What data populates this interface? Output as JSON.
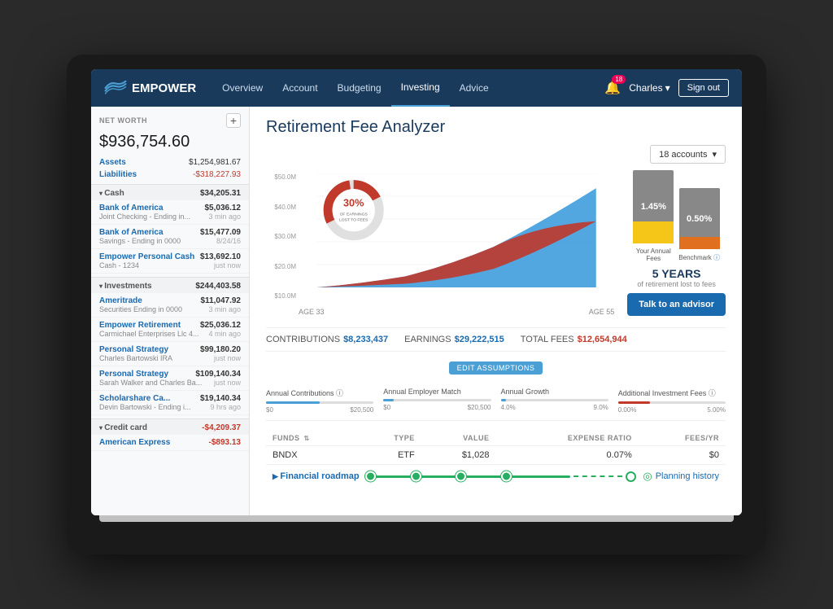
{
  "nav": {
    "logo": "EMPOWER",
    "links": [
      {
        "label": "Overview",
        "active": false
      },
      {
        "label": "Account",
        "active": false
      },
      {
        "label": "Budgeting",
        "active": false
      },
      {
        "label": "Investing",
        "active": true
      },
      {
        "label": "Advice",
        "active": false
      }
    ],
    "bell_count": "18",
    "user": "Charles",
    "signout": "Sign out"
  },
  "sidebar": {
    "header": "NET WORTH",
    "add_btn": "+",
    "net_worth": "$936,754.60",
    "assets_label": "Assets",
    "assets_value": "$1,254,981.67",
    "liabilities_label": "Liabilities",
    "liabilities_value": "-$318,227.93",
    "sections": [
      {
        "title": "Cash",
        "amount": "$34,205.31",
        "accounts": [
          {
            "name": "Bank of America",
            "sub": "Joint Checking - Ending in...",
            "value": "$5,036.12",
            "time": "3 min ago"
          },
          {
            "name": "Bank of America",
            "sub": "Savings - Ending in 0000",
            "value": "$15,477.09",
            "time": "8/24/16"
          },
          {
            "name": "Empower Personal Cash",
            "sub": "Cash - 1234",
            "value": "$13,692.10",
            "time": "just now"
          }
        ]
      },
      {
        "title": "Investments",
        "amount": "$244,403.58",
        "accounts": [
          {
            "name": "Ameritrade",
            "sub": "Securities Ending in 0000",
            "value": "$11,047.92",
            "time": "3 min ago"
          },
          {
            "name": "Empower Retirement",
            "sub": "Carmichael Enterprises Llc 4...",
            "value": "$25,036.12",
            "time": "4 min ago"
          },
          {
            "name": "Personal Strategy",
            "sub": "Charles Bartowski IRA",
            "value": "$99,180.20",
            "time": "just now"
          },
          {
            "name": "Personal Strategy",
            "sub": "Sarah Walker and Charles Ba...",
            "value": "$109,140.34",
            "time": "just now"
          },
          {
            "name": "Scholarshare Ca...",
            "sub": "Devin Bartowski - Ending i...",
            "value": "$19,140.34",
            "time": "9 hrs ago"
          }
        ]
      },
      {
        "title": "Credit card",
        "amount": "-$4,209.37",
        "accounts": [
          {
            "name": "American Express",
            "sub": "",
            "value": "-$893.13",
            "time": ""
          }
        ]
      }
    ]
  },
  "content": {
    "page_title": "Retirement Fee Analyzer",
    "accounts_btn": "18 accounts",
    "chart": {
      "age_start": "AGE 33",
      "age_end": "AGE 55",
      "y_labels": [
        "$50.0M",
        "$40.0M",
        "$30.0M",
        "$20.0M",
        "$10.0M"
      ],
      "donut_pct": "30%",
      "donut_sub1": "OF EARNINGS",
      "donut_sub2": "LOST TO FEES",
      "annual_fee_pct": "1.45%",
      "benchmark_pct": "0.50%",
      "annual_label": "Your Annual\nFees",
      "benchmark_label": "Benchmark",
      "years": "5 YEARS",
      "years_sub": "of retirement lost to fees"
    },
    "stats": {
      "contributions_label": "CONTRIBUTIONS",
      "contributions_value": "$8,233,437",
      "earnings_label": "EARNINGS",
      "earnings_value": "$29,222,515",
      "total_fees_label": "TOTAL FEES",
      "total_fees_value": "$12,654,944"
    },
    "advisor_btn": "Talk to an advisor",
    "edit_btn": "EDIT ASSUMPTIONS",
    "sliders": [
      {
        "label": "Annual Contributions ⓘ",
        "min": "$0",
        "max": "$20,500",
        "fill_pct": 50,
        "type": "blue"
      },
      {
        "label": "Annual Employer Match",
        "min": "$0",
        "max": "$20,500",
        "fill_pct": 0,
        "type": "blue"
      },
      {
        "label": "Annual Growth",
        "min": "4.0%",
        "max": "9.0%",
        "fill_pct": 0,
        "type": "blue"
      },
      {
        "label": "Additional Investment Fees ⓘ",
        "min": "0.00%",
        "max": "5.00%",
        "fill_pct": 30,
        "type": "red"
      }
    ],
    "table": {
      "headers": [
        "FUNDS",
        "TYPE",
        "VALUE",
        "EXPENSE RATIO",
        "FEES/YR"
      ],
      "rows": [
        {
          "fund": "BNDX",
          "type": "ETF",
          "value": "$1,028",
          "expense_ratio": "0.07%",
          "fees_yr": "$0"
        }
      ]
    },
    "roadmap": {
      "label": "Financial roadmap",
      "history": "Planning history"
    }
  }
}
